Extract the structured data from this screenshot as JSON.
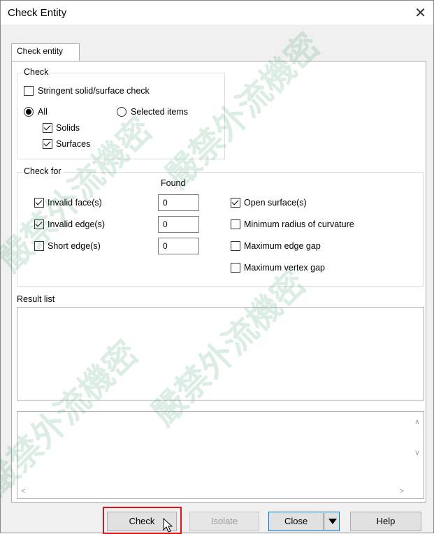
{
  "window": {
    "title": "Check Entity"
  },
  "tab": {
    "label": "Check entity"
  },
  "check_group": {
    "label": "Check",
    "stringent": {
      "label": "Stringent solid/surface check",
      "checked": false
    },
    "scope": {
      "all_label": "All",
      "selected_label": "Selected items",
      "selected": "All"
    },
    "solids": {
      "label": "Solids",
      "checked": true
    },
    "surfaces": {
      "label": "Surfaces",
      "checked": true
    }
  },
  "check_for": {
    "label": "Check for",
    "found_header": "Found",
    "left_items": [
      {
        "label": "Invalid face(s)",
        "checked": true,
        "found": "0"
      },
      {
        "label": "Invalid edge(s)",
        "checked": true,
        "found": "0"
      },
      {
        "label": "Short edge(s)",
        "checked": false,
        "found": "0"
      }
    ],
    "right_items": [
      {
        "label": "Open surface(s)",
        "checked": true
      },
      {
        "label": "Minimum radius of curvature",
        "checked": false
      },
      {
        "label": "Maximum edge gap",
        "checked": false
      },
      {
        "label": "Maximum vertex gap",
        "checked": false
      }
    ]
  },
  "result_list": {
    "label": "Result list"
  },
  "buttons": {
    "check": "Check",
    "isolate": "Isolate",
    "close": "Close",
    "help": "Help"
  },
  "watermark": {
    "text": "嚴禁外流機密"
  },
  "colors": {
    "highlight_frame": "#d8161e",
    "focus_border": "#0078d7"
  }
}
